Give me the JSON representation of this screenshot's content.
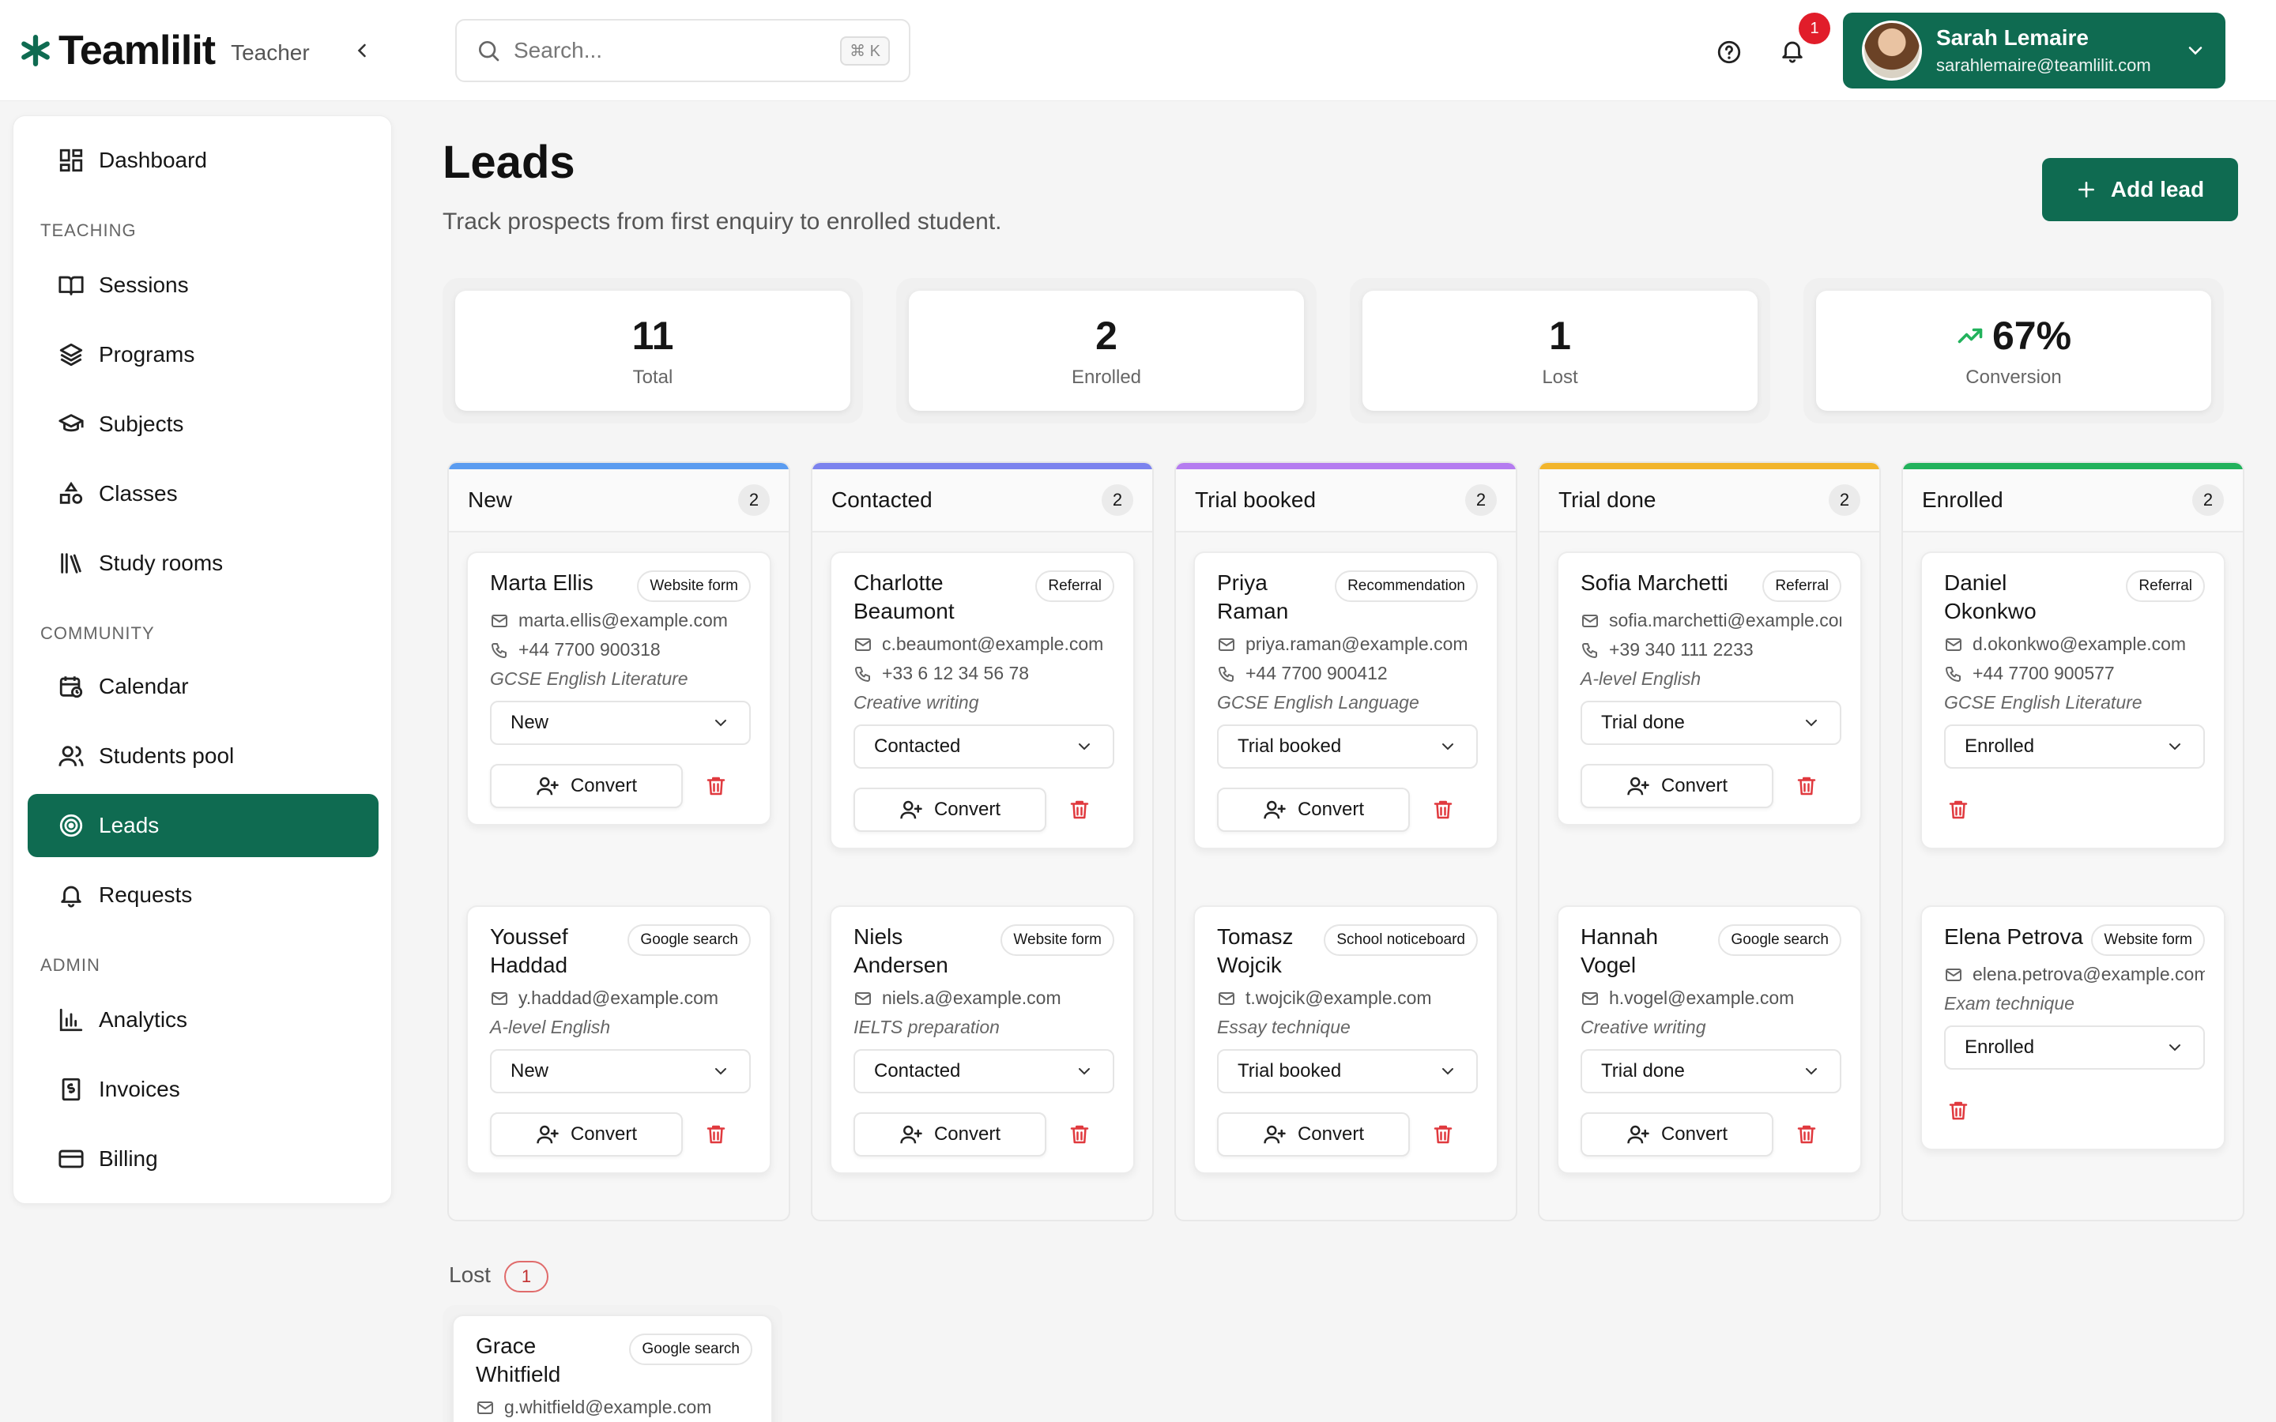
{
  "app": {
    "brand": "Teamlilit",
    "role": "Teacher",
    "accent": "#0f6b51"
  },
  "search": {
    "placeholder": "Search...",
    "shortcut": "⌘ K"
  },
  "notifications": {
    "count": "1"
  },
  "user": {
    "name": "Sarah Lemaire",
    "email": "sarahlemaire@teamlilit.com"
  },
  "sidebar": {
    "dashboard": "Dashboard",
    "teaching_label": "TEACHING",
    "teaching": [
      "Sessions",
      "Programs",
      "Subjects",
      "Classes",
      "Study rooms"
    ],
    "community_label": "COMMUNITY",
    "community": [
      "Calendar",
      "Students pool",
      "Leads",
      "Requests"
    ],
    "admin_label": "ADMIN",
    "admin": [
      "Analytics",
      "Invoices",
      "Billing"
    ],
    "active": "Leads"
  },
  "page": {
    "title": "Leads",
    "subtitle": "Track prospects from first enquiry to enrolled student.",
    "add_button": "Add lead"
  },
  "stats": [
    {
      "value": "11",
      "label": "Total"
    },
    {
      "value": "2",
      "label": "Enrolled"
    },
    {
      "value": "1",
      "label": "Lost"
    },
    {
      "value": "67%",
      "label": "Conversion",
      "trend": "up"
    }
  ],
  "convert_label": "Convert",
  "columns": [
    {
      "name": "New",
      "count": "2",
      "color": "#5b9cf0",
      "cards": [
        {
          "name": "Marta Ellis",
          "source": "Website form",
          "email": "marta.ellis@example.com",
          "phone": "+44 7700 900318",
          "subject": "GCSE English Literature",
          "status": "New"
        },
        {
          "name": "Youssef Haddad",
          "source": "Google search",
          "email": "y.haddad@example.com",
          "phone": "",
          "subject": "A-level English",
          "status": "New"
        }
      ]
    },
    {
      "name": "Contacted",
      "count": "2",
      "color": "#7c83ee",
      "cards": [
        {
          "name": "Charlotte Beaumont",
          "source": "Referral",
          "email": "c.beaumont@example.com",
          "phone": "+33 6 12 34 56 78",
          "subject": "Creative writing",
          "status": "Contacted"
        },
        {
          "name": "Niels Andersen",
          "source": "Website form",
          "email": "niels.a@example.com",
          "phone": "",
          "subject": "IELTS preparation",
          "status": "Contacted"
        }
      ]
    },
    {
      "name": "Trial booked",
      "count": "2",
      "color": "#b57cf0",
      "cards": [
        {
          "name": "Priya Raman",
          "source": "Recommendation",
          "email": "priya.raman@example.com",
          "phone": "+44 7700 900412",
          "subject": "GCSE English Language",
          "status": "Trial booked"
        },
        {
          "name": "Tomasz Wojcik",
          "source": "School noticeboard",
          "email": "t.wojcik@example.com",
          "phone": "",
          "subject": "Essay technique",
          "status": "Trial booked"
        }
      ]
    },
    {
      "name": "Trial done",
      "count": "2",
      "color": "#f2b52c",
      "cards": [
        {
          "name": "Sofia Marchetti",
          "source": "Referral",
          "email": "sofia.marchetti@example.com",
          "phone": "+39 340 111 2233",
          "subject": "A-level English",
          "status": "Trial done"
        },
        {
          "name": "Hannah Vogel",
          "source": "Google search",
          "email": "h.vogel@example.com",
          "phone": "",
          "subject": "Creative writing",
          "status": "Trial done"
        }
      ]
    },
    {
      "name": "Enrolled",
      "count": "2",
      "color": "#22b25c",
      "cards": [
        {
          "name": "Daniel Okonkwo",
          "source": "Referral",
          "email": "d.okonkwo@example.com",
          "phone": "+44 7700 900577",
          "subject": "GCSE English Literature",
          "status": "Enrolled"
        },
        {
          "name": "Elena Petrova",
          "source": "Website form",
          "email": "elena.petrova@example.com",
          "phone": "",
          "subject": "Exam technique",
          "status": "Enrolled"
        }
      ]
    }
  ],
  "lost": {
    "label": "Lost",
    "count": "1",
    "card": {
      "name": "Grace Whitfield",
      "source": "Google search",
      "email": "g.whitfield@example.com"
    }
  }
}
